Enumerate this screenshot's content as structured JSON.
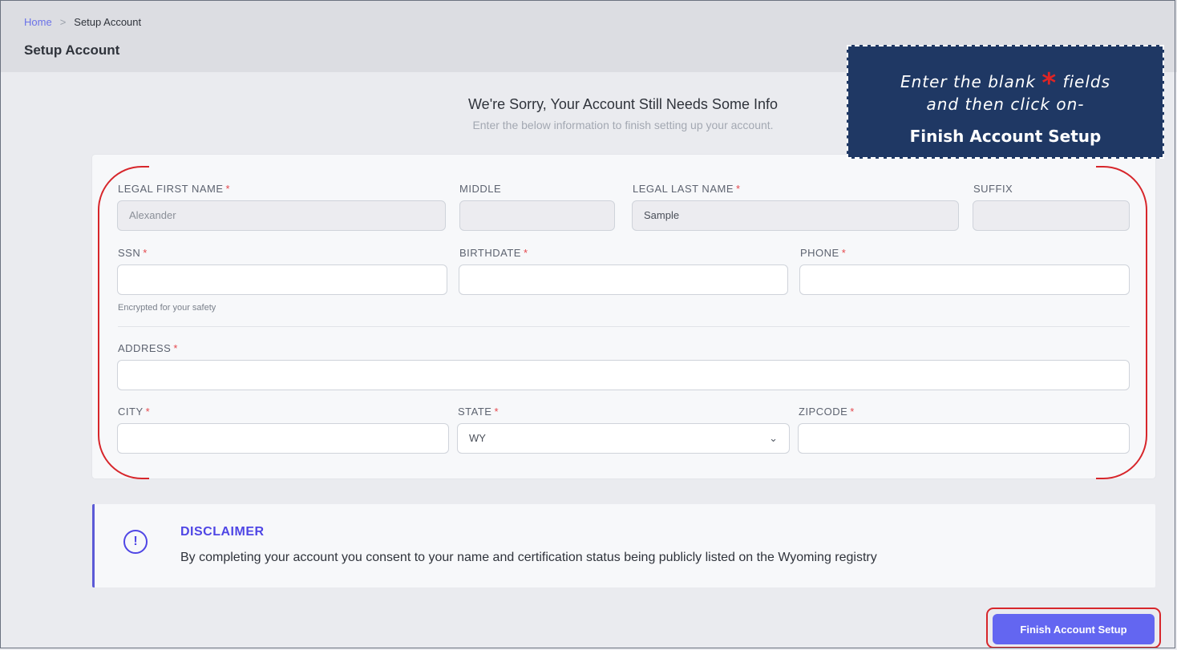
{
  "breadcrumb": {
    "home": "Home",
    "separator": ">",
    "current": "Setup Account"
  },
  "page": {
    "title": "Setup Account"
  },
  "callout": {
    "line1_pre": "Enter the blank",
    "star": "*",
    "line1_post": "fields",
    "line2": "and then click on-",
    "line3": "Finish Account Setup"
  },
  "header": {
    "title": "We're Sorry, Your Account Still Needs Some Info",
    "subtitle": "Enter the below information to finish setting up your account."
  },
  "required_marker": "*",
  "form": {
    "first_name": {
      "label": "LEGAL FIRST NAME",
      "value": "Alexander"
    },
    "middle": {
      "label": "MIDDLE",
      "value": ""
    },
    "last_name": {
      "label": "LEGAL LAST NAME",
      "value": "Sample"
    },
    "suffix": {
      "label": "SUFFIX",
      "value": ""
    },
    "ssn": {
      "label": "SSN",
      "value": "",
      "hint": "Encrypted for your safety"
    },
    "birthdate": {
      "label": "BIRTHDATE",
      "value": ""
    },
    "phone": {
      "label": "PHONE",
      "value": ""
    },
    "address": {
      "label": "ADDRESS",
      "value": ""
    },
    "city": {
      "label": "CITY",
      "value": ""
    },
    "state": {
      "label": "STATE",
      "value": "WY"
    },
    "zipcode": {
      "label": "ZIPCODE",
      "value": ""
    }
  },
  "disclaimer": {
    "icon": "exclamation-circle-icon",
    "title": "DISCLAIMER",
    "text": "By completing your account you consent to your name and certification status being publicly listed on the Wyoming registry"
  },
  "actions": {
    "finish": "Finish Account Setup"
  },
  "colors": {
    "accent": "#6366f1",
    "required": "#e5484d",
    "annotation": "#d7262b",
    "callout_bg": "#1f3864"
  }
}
